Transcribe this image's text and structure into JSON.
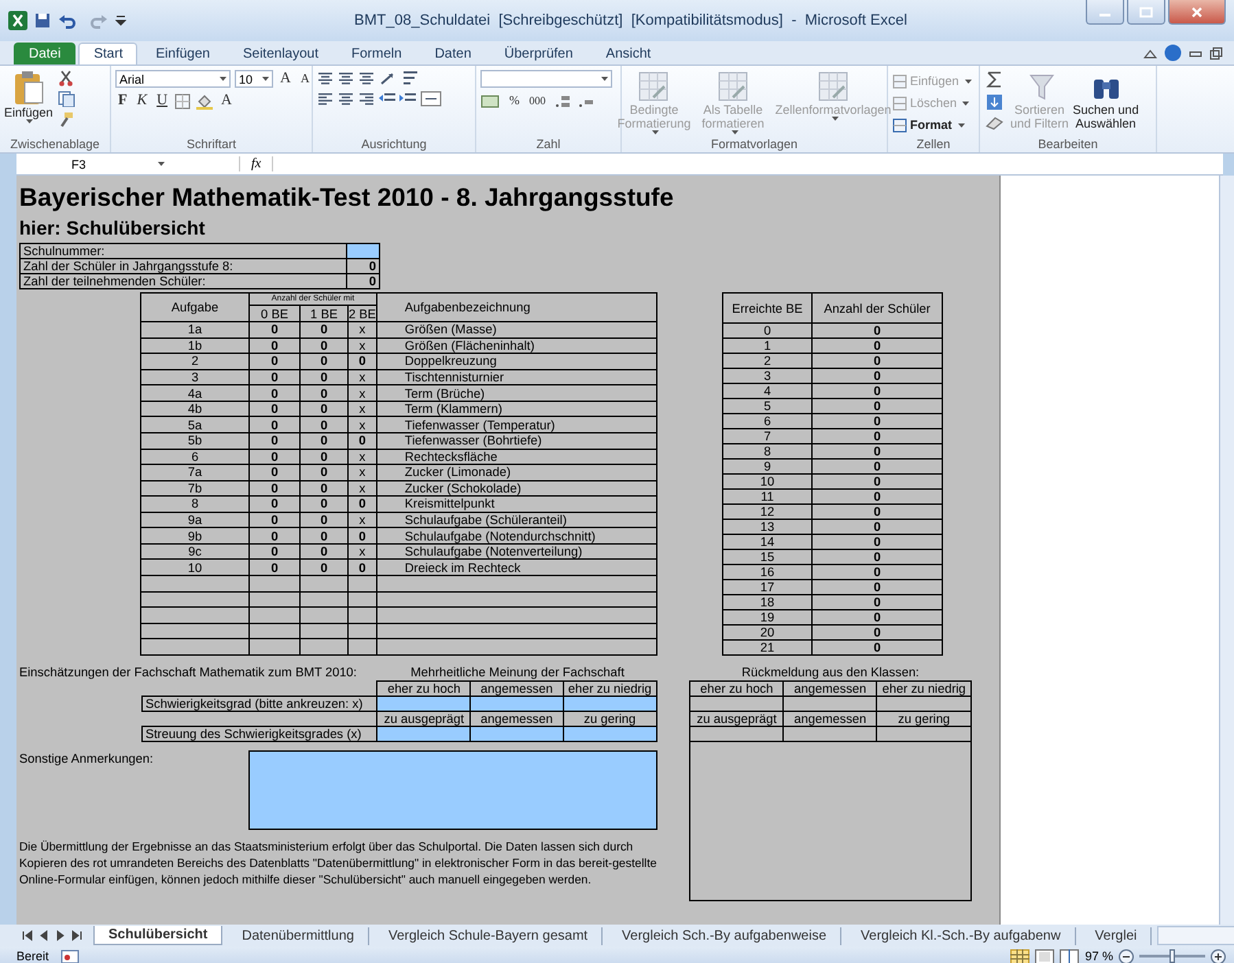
{
  "window": {
    "title": "BMT_08_Schuldatei  [Schreibgeschützt]  [Kompatibilitätsmodus]  -  Microsoft Excel"
  },
  "ribbon": {
    "tabs": [
      {
        "label": "Datei",
        "kind": "file",
        "selected": false
      },
      {
        "label": "Start",
        "kind": "tab",
        "selected": true
      },
      {
        "label": "Einfügen",
        "kind": "tab",
        "selected": false
      },
      {
        "label": "Seitenlayout",
        "kind": "tab",
        "selected": false
      },
      {
        "label": "Formeln",
        "kind": "tab",
        "selected": false
      },
      {
        "label": "Daten",
        "kind": "tab",
        "selected": false
      },
      {
        "label": "Überprüfen",
        "kind": "tab",
        "selected": false
      },
      {
        "label": "Ansicht",
        "kind": "tab",
        "selected": false
      }
    ],
    "clipboard": {
      "label": "Zwischenablage",
      "paste": "Einfügen"
    },
    "font": {
      "label": "Schriftart",
      "font_name": "Arial",
      "font_size": "10",
      "grow": "A",
      "shrink": "A",
      "bold": "F",
      "italic": "K",
      "underline": "U",
      "font_color_label": "A"
    },
    "alignment": {
      "label": "Ausrichtung"
    },
    "number": {
      "label": "Zahl",
      "percent": "%",
      "thousands": "000"
    },
    "styles": {
      "label": "Formatvorlagen",
      "items": [
        {
          "lines": [
            "Bedingte",
            "Formatierung"
          ],
          "disabled": true
        },
        {
          "lines": [
            "Als Tabelle",
            "formatieren"
          ],
          "disabled": true
        },
        {
          "lines": [
            "Zellenformatvorlagen"
          ],
          "disabled": true
        }
      ]
    },
    "cells": {
      "label": "Zellen",
      "items": [
        {
          "label": "Einfügen",
          "disabled": true
        },
        {
          "label": "Löschen",
          "disabled": true
        },
        {
          "label": "Format",
          "disabled": false
        }
      ]
    },
    "editing": {
      "label": "Bearbeiten",
      "items": [
        {
          "lines": [
            "Sortieren",
            "und Filtern"
          ],
          "disabled": true
        },
        {
          "lines": [
            "Suchen und",
            "Auswählen"
          ],
          "disabled": false
        }
      ]
    }
  },
  "formula_bar": {
    "name_box": "F3",
    "function_label": "fx"
  },
  "sheet": {
    "title": "Bayerischer Mathematik-Test 2010 - 8. Jahrgangsstufe",
    "subtitle": "hier: Schulübersicht",
    "info": [
      {
        "label": "Schulnummer:",
        "kind": "input"
      },
      {
        "label": "Zahl der Schüler in Jahrgangsstufe 8:",
        "kind": "count",
        "value": "0"
      },
      {
        "label": "Zahl der teilnehmenden Schüler:",
        "kind": "count",
        "value": "0"
      }
    ],
    "tasks": {
      "col_task": "Aufgabe",
      "group_header": "Anzahl der Schüler mit",
      "col_be0": "0 BE",
      "col_be1": "1 BE",
      "col_be2": "2 BE",
      "col_name": "Aufgabenbezeichnung",
      "rows": [
        {
          "task": "1a",
          "be0": "0",
          "be1": "0",
          "be2": "x",
          "be2_applicable": false,
          "name": "Größen (Masse)"
        },
        {
          "task": "1b",
          "be0": "0",
          "be1": "0",
          "be2": "x",
          "be2_applicable": false,
          "name": "Größen (Flächeninhalt)"
        },
        {
          "task": "2",
          "be0": "0",
          "be1": "0",
          "be2": "0",
          "be2_applicable": true,
          "name": "Doppelkreuzung"
        },
        {
          "task": "3",
          "be0": "0",
          "be1": "0",
          "be2": "x",
          "be2_applicable": false,
          "name": "Tischtennisturnier"
        },
        {
          "task": "4a",
          "be0": "0",
          "be1": "0",
          "be2": "x",
          "be2_applicable": false,
          "name": "Term (Brüche)"
        },
        {
          "task": "4b",
          "be0": "0",
          "be1": "0",
          "be2": "x",
          "be2_applicable": false,
          "name": "Term (Klammern)"
        },
        {
          "task": "5a",
          "be0": "0",
          "be1": "0",
          "be2": "x",
          "be2_applicable": false,
          "name": "Tiefenwasser (Temperatur)"
        },
        {
          "task": "5b",
          "be0": "0",
          "be1": "0",
          "be2": "0",
          "be2_applicable": true,
          "name": "Tiefenwasser (Bohrtiefe)"
        },
        {
          "task": "6",
          "be0": "0",
          "be1": "0",
          "be2": "x",
          "be2_applicable": false,
          "name": "Rechtecksfläche"
        },
        {
          "task": "7a",
          "be0": "0",
          "be1": "0",
          "be2": "x",
          "be2_applicable": false,
          "name": "Zucker (Limonade)"
        },
        {
          "task": "7b",
          "be0": "0",
          "be1": "0",
          "be2": "x",
          "be2_applicable": false,
          "name": "Zucker (Schokolade)"
        },
        {
          "task": "8",
          "be0": "0",
          "be1": "0",
          "be2": "0",
          "be2_applicable": true,
          "name": "Kreismittelpunkt"
        },
        {
          "task": "9a",
          "be0": "0",
          "be1": "0",
          "be2": "x",
          "be2_applicable": false,
          "name": "Schulaufgabe (Schüleranteil)"
        },
        {
          "task": "9b",
          "be0": "0",
          "be1": "0",
          "be2": "0",
          "be2_applicable": true,
          "name": "Schulaufgabe (Notendurchschnitt)"
        },
        {
          "task": "9c",
          "be0": "0",
          "be1": "0",
          "be2": "x",
          "be2_applicable": false,
          "name": "Schulaufgabe (Notenverteilung)"
        },
        {
          "task": "10",
          "be0": "0",
          "be1": "0",
          "be2": "0",
          "be2_applicable": true,
          "name": "Dreieck im Rechteck"
        }
      ]
    },
    "be_table": {
      "col_be": "Erreichte BE",
      "col_count": "Anzahl der Schüler",
      "rows": [
        {
          "be": "0",
          "count": "0"
        },
        {
          "be": "1",
          "count": "0"
        },
        {
          "be": "2",
          "count": "0"
        },
        {
          "be": "3",
          "count": "0"
        },
        {
          "be": "4",
          "count": "0"
        },
        {
          "be": "5",
          "count": "0"
        },
        {
          "be": "6",
          "count": "0"
        },
        {
          "be": "7",
          "count": "0"
        },
        {
          "be": "8",
          "count": "0"
        },
        {
          "be": "9",
          "count": "0"
        },
        {
          "be": "10",
          "count": "0"
        },
        {
          "be": "11",
          "count": "0"
        },
        {
          "be": "12",
          "count": "0"
        },
        {
          "be": "13",
          "count": "0"
        },
        {
          "be": "14",
          "count": "0"
        },
        {
          "be": "15",
          "count": "0"
        },
        {
          "be": "16",
          "count": "0"
        },
        {
          "be": "17",
          "count": "0"
        },
        {
          "be": "18",
          "count": "0"
        },
        {
          "be": "19",
          "count": "0"
        },
        {
          "be": "20",
          "count": "0"
        },
        {
          "be": "21",
          "count": "0"
        }
      ]
    },
    "assessment": {
      "label": "Einschätzungen der Fachschaft Mathematik zum BMT 2010:",
      "heading": "Mehrheitliche Meinung der Fachschaft",
      "difficulty": {
        "label": "Schwierigkeitsgrad (bitte ankreuzen: x)",
        "options": [
          "eher zu hoch",
          "angemessen",
          "eher zu niedrig"
        ]
      },
      "spread": {
        "label": "Streuung des Schwierigkeitsgrades (x)",
        "options": [
          "zu ausgeprägt",
          "angemessen",
          "zu gering"
        ]
      }
    },
    "feedback": {
      "heading": "Rückmeldung aus den Klassen:",
      "difficulty_options": [
        "eher zu hoch",
        "angemessen",
        "eher zu niedrig"
      ],
      "spread_options": [
        "zu ausgeprägt",
        "angemessen",
        "zu gering"
      ]
    },
    "remarks": {
      "label": "Sonstige Anmerkungen:"
    },
    "footer": "Die Übermittlung der Ergebnisse an das Staatsministerium erfolgt über das Schulportal. Die Daten lassen sich durch Kopieren des rot umrandeten Bereichs des Datenblatts \"Datenübermittlung\" in elektronischer Form in das bereit-gestellte Online-Formular einfügen, können jedoch mithilfe dieser \"Schulübersicht\" auch manuell eingegeben werden."
  },
  "sheet_tabs": [
    {
      "label": "Schulübersicht",
      "selected": true
    },
    {
      "label": "Datenübermittlung",
      "selected": false
    },
    {
      "label": "Vergleich Schule-Bayern gesamt",
      "selected": false
    },
    {
      "label": "Vergleich Sch.-By aufgabenweise",
      "selected": false
    },
    {
      "label": "Vergleich Kl.-Sch.-By aufgabenw",
      "selected": false
    },
    {
      "label": "Verglei",
      "selected": false
    }
  ],
  "status_bar": {
    "status": "Bereit",
    "zoom": "97 %",
    "zoom_slider": {
      "level": 0.5
    }
  }
}
